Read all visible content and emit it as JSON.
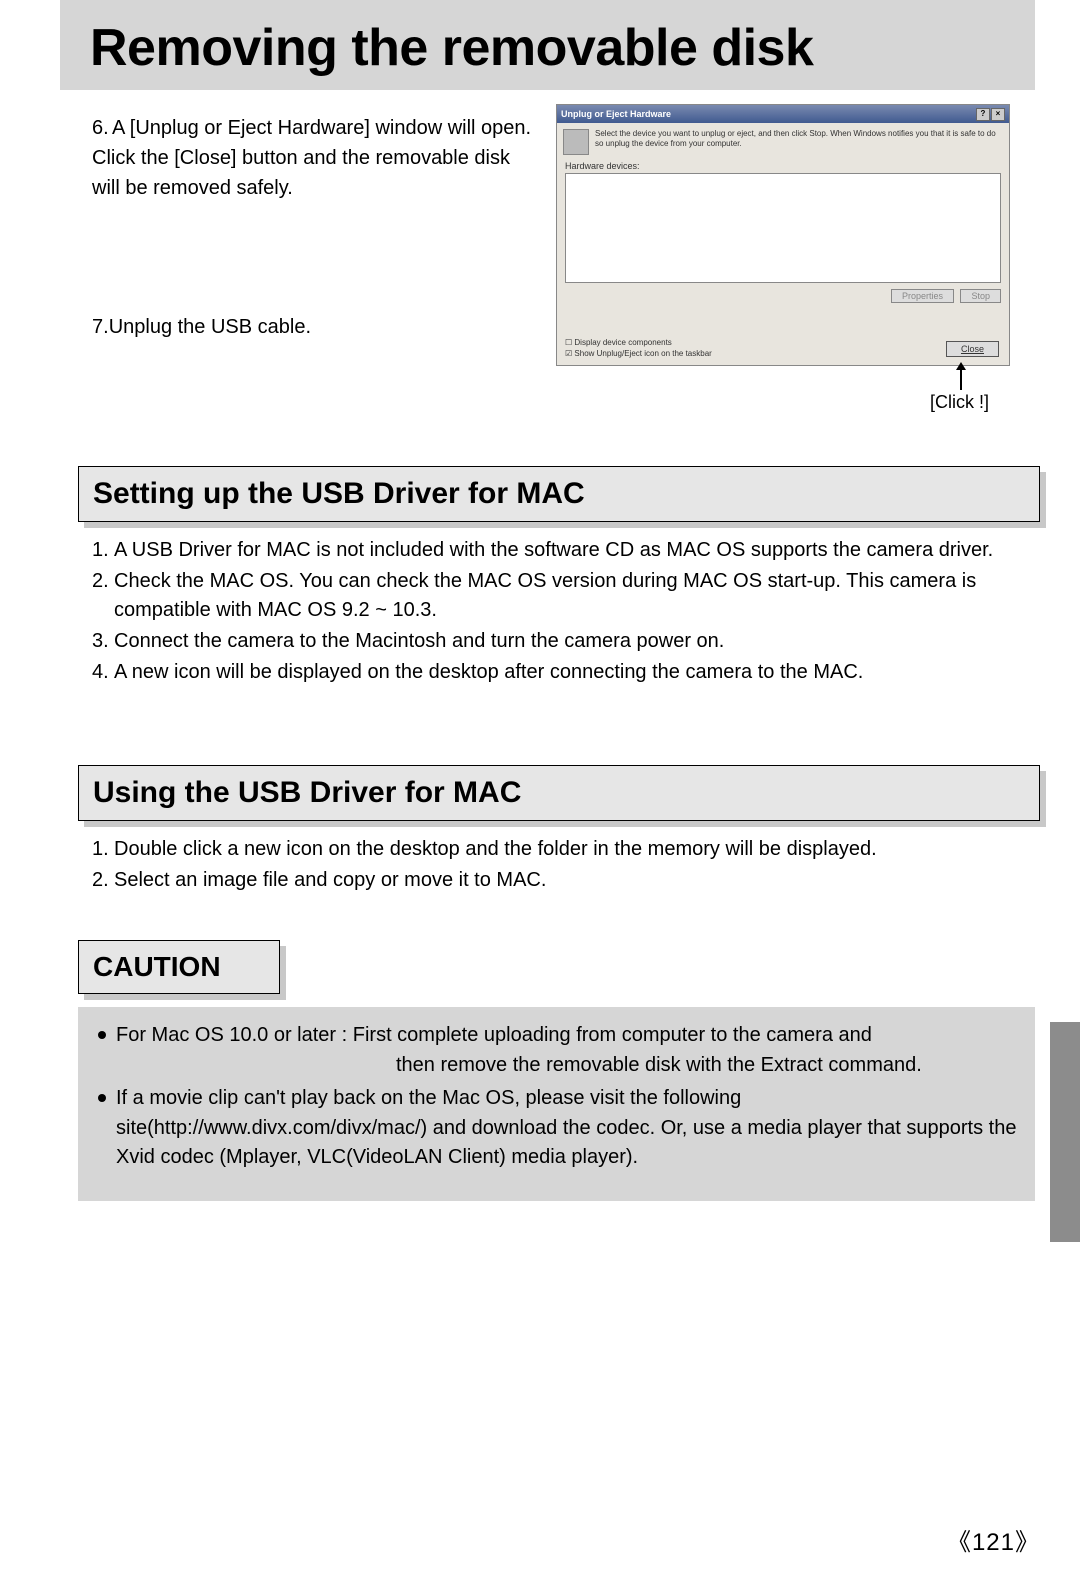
{
  "page_title": "Removing the removable disk",
  "steps_a": {
    "s6_num": "6.",
    "s6_text": "A [Unplug or Eject Hardware] window will open. Click the [Close] button and the removable disk will be removed safely.",
    "s7_num": "7.",
    "s7_text": "Unplug the USB cable."
  },
  "screenshot": {
    "title": "Unplug or Eject Hardware",
    "help_btn": "?",
    "close_x": "×",
    "desc": "Select the device you want to unplug or eject, and then click Stop. When Windows notifies you that it is safe to do so unplug the device from your computer.",
    "hw_label": "Hardware devices:",
    "btn_properties": "Properties",
    "btn_stop": "Stop",
    "chk1": "Display device components",
    "chk2": "Show Unplug/Eject icon on the taskbar",
    "btn_close": "Close"
  },
  "click_label": "[Click !]",
  "section1": "Setting up the USB Driver for MAC",
  "section1_items": [
    {
      "n": "1.",
      "t": "A USB Driver for MAC is not included with the software CD as MAC OS supports the camera driver."
    },
    {
      "n": "2.",
      "t": "Check the MAC OS. You can check the MAC OS version during MAC OS start-up. This camera is compatible with MAC OS 9.2 ~ 10.3."
    },
    {
      "n": "3.",
      "t": "Connect the camera to the Macintosh and turn the camera power on."
    },
    {
      "n": "4.",
      "t": "A new icon will be displayed on the desktop after connecting the camera to the MAC."
    }
  ],
  "section2": "Using the USB Driver for MAC",
  "section2_items": [
    {
      "n": "1.",
      "t": "Double click a new icon on the desktop and the folder in the memory will be displayed."
    },
    {
      "n": "2.",
      "t": "Select an image file and copy or move it to MAC."
    }
  ],
  "section3": "CAUTION",
  "caution": {
    "b1a": "For Mac OS 10.0 or later : First complete uploading from computer to the camera and",
    "b1b": "then remove the removable disk with the Extract command.",
    "b2": "If a movie clip can't play back on the Mac OS, please visit the following site(http://www.divx.com/divx/mac/) and download the codec. Or, use a media player that supports the Xvid codec (Mplayer, VLC(VideoLAN Client) media player)."
  },
  "page_number": "121"
}
